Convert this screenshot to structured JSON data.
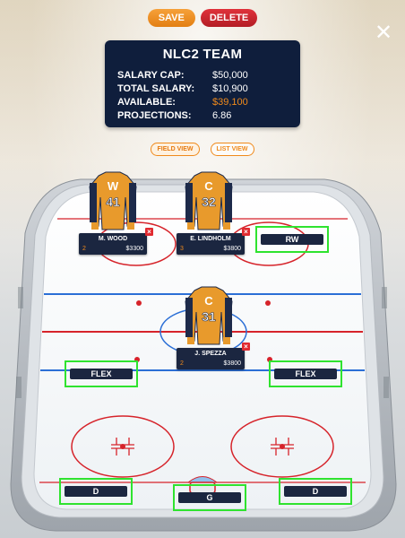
{
  "toolbar": {
    "save_label": "SAVE",
    "delete_label": "DELETE",
    "close_symbol": "✕"
  },
  "team": {
    "title": "NLC2 TEAM",
    "stats": [
      {
        "label": "SALARY CAP:",
        "value": "$50,000",
        "highlight": false
      },
      {
        "label": "TOTAL SALARY:",
        "value": "$10,900",
        "highlight": false
      },
      {
        "label": "AVAILABLE:",
        "value": "$39,100",
        "highlight": true
      },
      {
        "label": "PROJECTIONS:",
        "value": "6.86",
        "highlight": false
      }
    ]
  },
  "views": {
    "field_label": "FIELD VIEW",
    "list_label": "LIST VIEW",
    "active": "field"
  },
  "players": [
    {
      "name": "M. WOOD",
      "slot_number": "2",
      "salary": "$3300",
      "jersey_letter": "W",
      "jersey_number": "41"
    },
    {
      "name": "E. LINDHOLM",
      "slot_number": "3",
      "salary": "$3800",
      "jersey_letter": "C",
      "jersey_number": "32"
    },
    {
      "name": "J. SPEZZA",
      "slot_number": "2",
      "salary": "$3800",
      "jersey_letter": "C",
      "jersey_number": "31"
    }
  ],
  "empty_slots": {
    "rw": "RW",
    "flex_left": "FLEX",
    "flex_right": "FLEX",
    "d_left": "D",
    "goalie": "G",
    "d_right": "D"
  },
  "colors": {
    "accent": "#f08a1b",
    "navy": "#0f1e3c",
    "delete": "#e12a30",
    "slot_highlight": "#2fe32f",
    "rink_line_red": "#d6232a",
    "rink_line_blue": "#2b6fd6"
  },
  "remove_symbol": "×"
}
